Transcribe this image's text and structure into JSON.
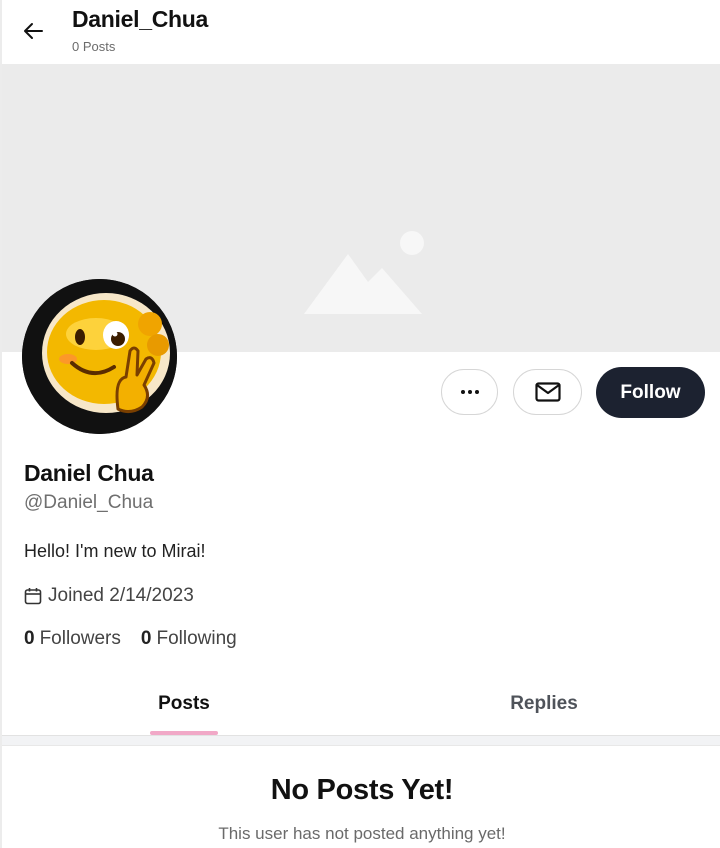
{
  "header": {
    "title": "Daniel_Chua",
    "post_count": "0 Posts"
  },
  "profile": {
    "display_name": "Daniel Chua",
    "handle": "@Daniel_Chua",
    "bio": "Hello! I'm new to Mirai!",
    "joined": "Joined 2/14/2023",
    "followers_count": "0",
    "followers_label": "Followers",
    "following_count": "0",
    "following_label": "Following"
  },
  "actions": {
    "follow_label": "Follow",
    "more_icon": "more-horizontal-icon",
    "message_icon": "envelope-icon"
  },
  "tabs": [
    {
      "label": "Posts",
      "active": true
    },
    {
      "label": "Replies",
      "active": false
    }
  ],
  "empty_state": {
    "title": "No Posts Yet!",
    "subtitle": "This user has not posted anything yet!"
  },
  "colors": {
    "follow_button_bg": "#1c2230",
    "tab_indicator": "#f1a8c7",
    "banner_bg": "#ebebeb"
  }
}
